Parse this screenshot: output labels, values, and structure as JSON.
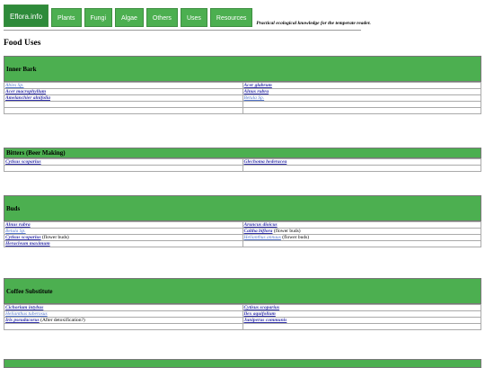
{
  "nav": {
    "brand": "Eflora.info",
    "items": [
      "Plants",
      "Fungi",
      "Algae",
      "Others",
      "Uses",
      "Resources"
    ],
    "tagline": "Practical ecological knowledge for the temperate reader."
  },
  "page_title": "Food Uses",
  "colors": {
    "accent": "#4caf50",
    "link": "#3333aa"
  },
  "sections": [
    {
      "title": "Inner Bark",
      "rows": [
        [
          {
            "name": "Abies Sp.",
            "bold": false,
            "light": true,
            "note": ""
          },
          {
            "name": "Acer glabrum",
            "bold": true,
            "light": false,
            "note": ""
          }
        ],
        [
          {
            "name": "Acer macrophyllum",
            "bold": true,
            "light": false,
            "note": ""
          },
          {
            "name": "Alnus rubra",
            "bold": true,
            "light": false,
            "note": ""
          }
        ],
        [
          {
            "name": "Amelanchier alnifolia",
            "bold": true,
            "light": false,
            "note": ""
          },
          {
            "name": "Betula Sp.",
            "bold": false,
            "light": true,
            "note": ""
          }
        ],
        [
          null,
          null
        ],
        [
          null,
          null
        ]
      ]
    },
    {
      "title": "Bitters (Beer Making)",
      "rows": [
        [
          {
            "name": "Cytisus scoparius",
            "bold": true,
            "light": false,
            "note": ""
          },
          {
            "name": "Glechoma hederacea",
            "bold": true,
            "light": false,
            "note": ""
          }
        ],
        [
          null,
          null
        ]
      ]
    },
    {
      "title": "Buds",
      "rows": [
        [
          {
            "name": "Alnus rubra",
            "bold": true,
            "light": false,
            "note": ""
          },
          {
            "name": "Aruncus dioicus",
            "bold": true,
            "light": false,
            "note": ""
          }
        ],
        [
          {
            "name": "Betula Sp.",
            "bold": false,
            "light": true,
            "note": ""
          },
          {
            "name": "Caltha biflora",
            "bold": true,
            "light": false,
            "note": "(flower buds)"
          }
        ],
        [
          {
            "name": "Cytisus scoparius",
            "bold": true,
            "light": false,
            "note": "(flower buds)"
          },
          {
            "name": "Helianthus annuus",
            "bold": false,
            "light": true,
            "note": "(flower buds)"
          }
        ],
        [
          {
            "name": "Heracleum maximum",
            "bold": true,
            "light": false,
            "note": ""
          },
          null
        ]
      ]
    },
    {
      "title": "Coffee Substitute",
      "rows": [
        [
          {
            "name": "Cichorium intybus",
            "bold": true,
            "light": false,
            "note": ""
          },
          {
            "name": "Cytisus scoparius",
            "bold": true,
            "light": false,
            "note": ""
          }
        ],
        [
          {
            "name": "Helianthus tuberosus",
            "bold": false,
            "light": true,
            "note": ""
          },
          {
            "name": "Ilex aquifolium",
            "bold": true,
            "light": false,
            "note": ""
          }
        ],
        [
          {
            "name": "Iris pseudacorus",
            "bold": true,
            "light": false,
            "note": "(After detoxification?)"
          },
          {
            "name": "Juniperus communis",
            "bold": true,
            "light": false,
            "note": ""
          }
        ],
        [
          null,
          null
        ]
      ]
    }
  ]
}
